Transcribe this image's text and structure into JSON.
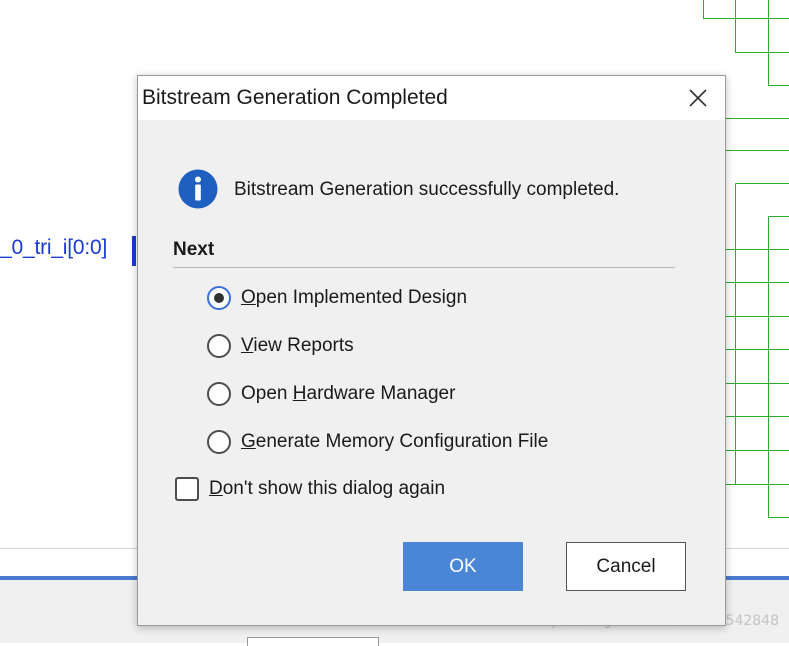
{
  "background": {
    "port_label": "_0_tri_i[0:0]",
    "watermark": "https://blog.csdn.net/a2207542848",
    "colors": {
      "wire": "#2eaa2e",
      "port": "#1a3bd6",
      "panel_accent": "#4a7bd0"
    }
  },
  "dialog": {
    "title": "Bitstream Generation Completed",
    "close_icon": "close-icon",
    "info_icon": "info-icon",
    "message": "Bitstream Generation successfully completed.",
    "section_title": "Next",
    "options": [
      {
        "pre": "",
        "mnemonic": "O",
        "post": "pen Implemented Design",
        "selected": true
      },
      {
        "pre": "",
        "mnemonic": "V",
        "post": "iew Reports",
        "selected": false
      },
      {
        "pre": "Open ",
        "mnemonic": "H",
        "post": "ardware Manager",
        "selected": false
      },
      {
        "pre": "",
        "mnemonic": "G",
        "post": "enerate Memory Configuration File",
        "selected": false
      }
    ],
    "checkbox": {
      "pre": "",
      "mnemonic": "D",
      "post": "on't show this dialog again",
      "checked": false
    },
    "ok_label": "OK",
    "cancel_label": "Cancel",
    "colors": {
      "ok_bg": "#4a85d6",
      "info_icon": "#1f5fbf"
    }
  }
}
